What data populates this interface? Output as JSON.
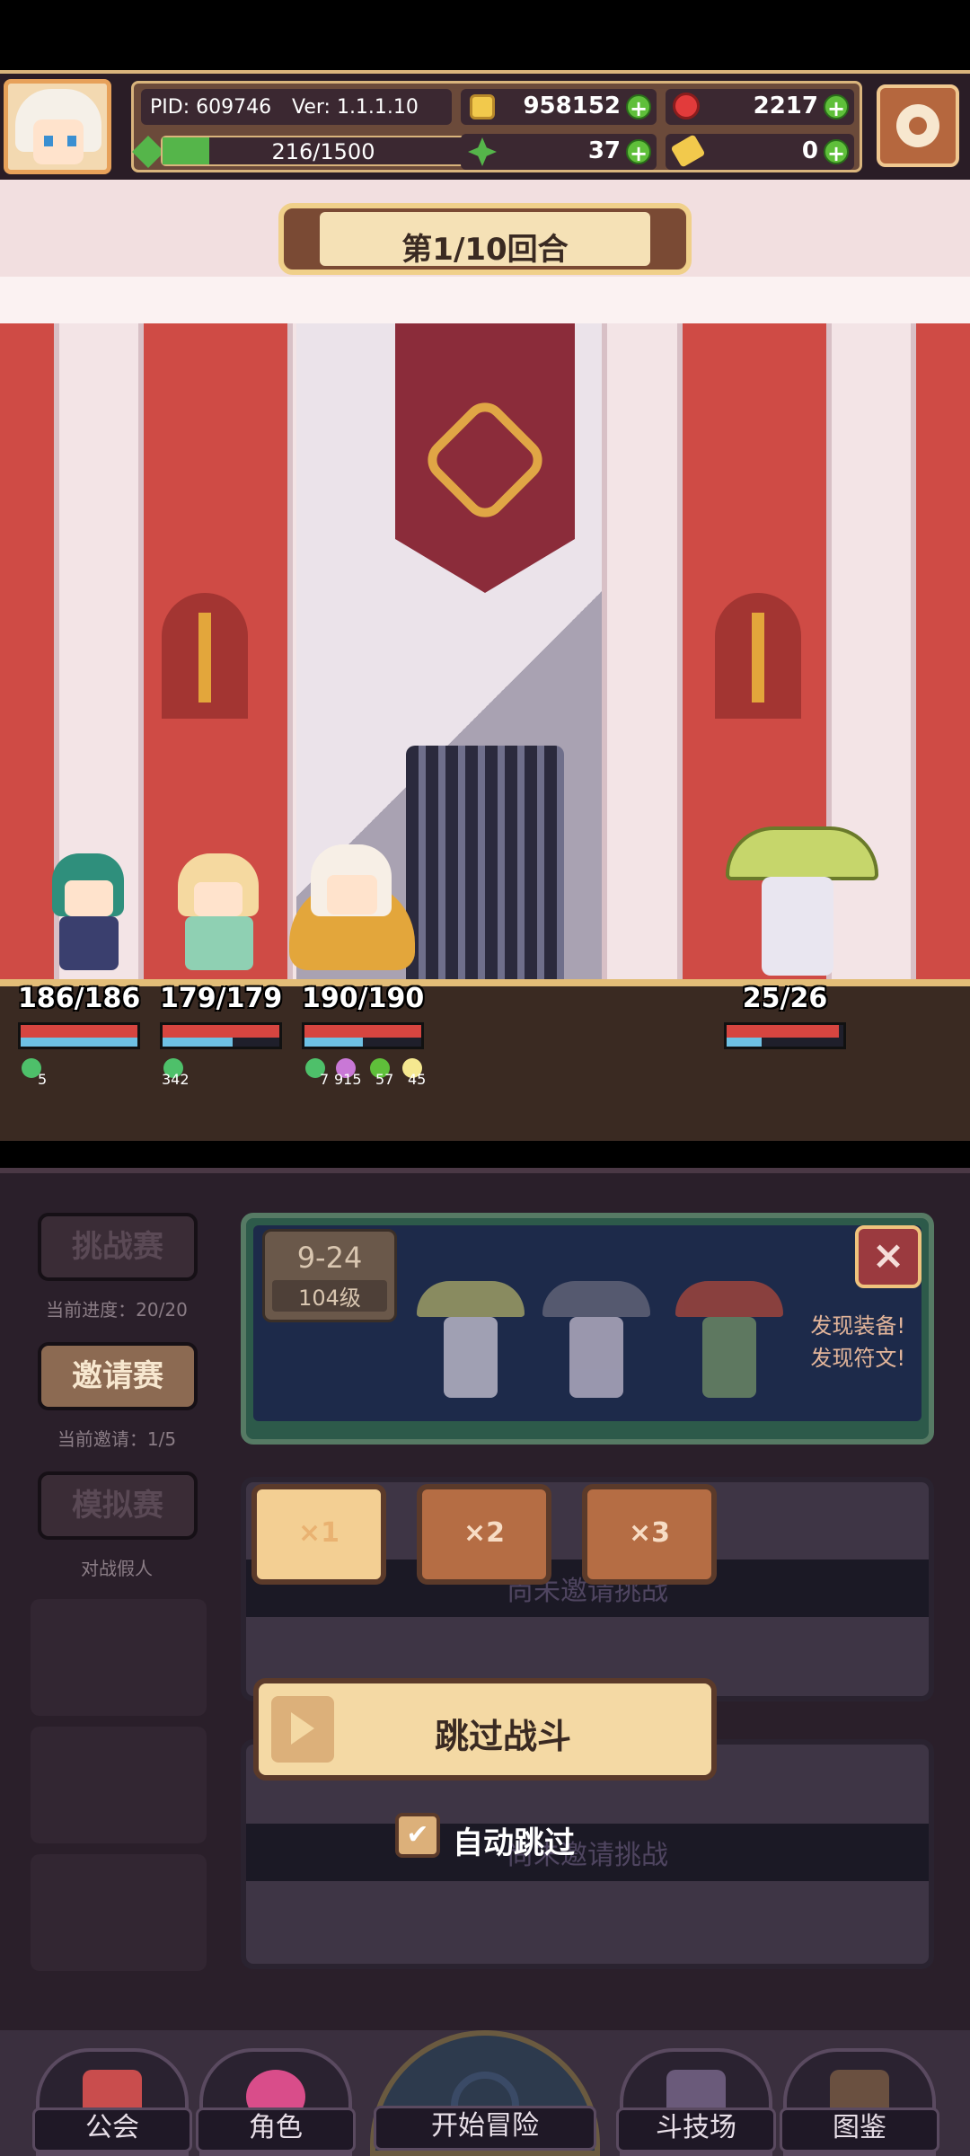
{
  "hud": {
    "pid": "PID: 609746",
    "version": "Ver: 1.1.1.10",
    "gold": "958152",
    "gems": "2217",
    "energy": "216/1500",
    "energy_ratio": 0.144,
    "clover": "37",
    "key": "0",
    "colors": {
      "accent_border": "#d9b47c",
      "plus": "#5fbf3a"
    }
  },
  "battle": {
    "round_text": "第1/10回合",
    "heroes": [
      {
        "hp": "186/186",
        "hp_ratio": 1.0,
        "mp_ratio": 1.0,
        "buffs": [
          "5"
        ]
      },
      {
        "hp": "179/179",
        "hp_ratio": 1.0,
        "mp_ratio": 0.6,
        "buffs": [
          "342"
        ]
      },
      {
        "hp": "190/190",
        "hp_ratio": 1.0,
        "mp_ratio": 0.5,
        "buffs": [
          "7",
          "915",
          "57",
          "45"
        ]
      }
    ],
    "enemy": {
      "hp": "25/26",
      "hp_ratio": 0.96,
      "mp_ratio": 0.3
    }
  },
  "sidebar": {
    "challenge": {
      "label": "挑战赛",
      "sub": "当前进度：20/20"
    },
    "invite": {
      "label": "邀请赛",
      "sub": "当前邀请：1/5"
    },
    "mock": {
      "label": "模拟赛",
      "sub": "对战假人"
    }
  },
  "stage": {
    "stage_no": "9-24",
    "level": "104级",
    "found_equip": "发现装备!",
    "found_rune": "发现符文!",
    "close_icon": "close-icon"
  },
  "rows": {
    "ghost1": "尚未邀请挑战",
    "ghost2": "尚未邀请挑战"
  },
  "controls": {
    "speed1": "×1",
    "speed2": "×2",
    "speed3": "×3",
    "skip": "跳过战斗",
    "auto_skip": "自动跳过",
    "auto_checked": "✔"
  },
  "nav": {
    "guild": "公会",
    "character": "角色",
    "adventure": "开始冒险",
    "arena": "斗技场",
    "codex": "图鉴"
  }
}
